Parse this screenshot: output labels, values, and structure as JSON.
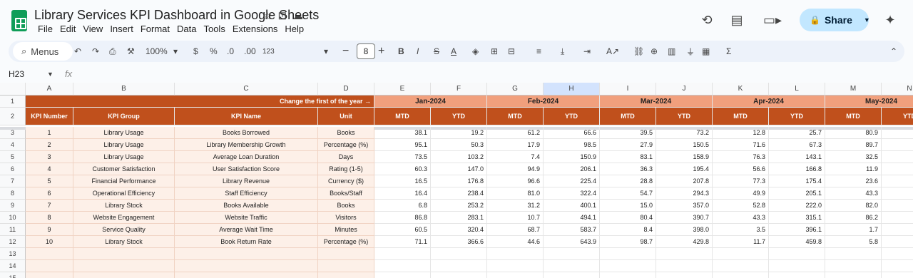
{
  "app": {
    "title": "Library Services KPI Dashboard in Google Sheets",
    "menus": [
      "File",
      "Edit",
      "View",
      "Insert",
      "Format",
      "Data",
      "Tools",
      "Extensions",
      "Help"
    ],
    "share_label": "Share"
  },
  "toolbar": {
    "menus_label": "Menus",
    "zoom": "100%",
    "currency": "$",
    "percent": "%",
    "dec_decrease": ".0",
    "dec_increase": ".00",
    "number_format": "123",
    "font_size": "8"
  },
  "namebox": {
    "ref": "H23",
    "fx": "fx"
  },
  "columns": [
    "A",
    "B",
    "C",
    "D",
    "E",
    "F",
    "G",
    "H",
    "I",
    "J",
    "K",
    "L",
    "M",
    "N"
  ],
  "rows": [
    "1",
    "2",
    "3",
    "4",
    "5",
    "6",
    "7",
    "8",
    "9",
    "10",
    "11",
    "12",
    "13",
    "14",
    "15"
  ],
  "sheet": {
    "banner": "Change the first of the year →",
    "months": [
      "Jan-2024",
      "Feb-2024",
      "Mar-2024",
      "Apr-2024",
      "May-2024"
    ],
    "headers": [
      "KPI Number",
      "KPI Group",
      "KPI Name",
      "Unit"
    ],
    "sub_headers": [
      "MTD",
      "YTD"
    ],
    "data": [
      [
        "1",
        "Library Usage",
        "Books Borrowed",
        "Books",
        "38.1",
        "19.2",
        "61.2",
        "66.6",
        "39.5",
        "73.2",
        "12.8",
        "25.7",
        "80.9",
        "33."
      ],
      [
        "2",
        "Library Usage",
        "Library Membership Growth",
        "Percentage (%)",
        "95.1",
        "50.3",
        "17.9",
        "98.5",
        "27.9",
        "150.5",
        "71.6",
        "67.3",
        "89.7",
        "85."
      ],
      [
        "3",
        "Library Usage",
        "Average Loan Duration",
        "Days",
        "73.5",
        "103.2",
        "7.4",
        "150.9",
        "83.1",
        "158.9",
        "76.3",
        "143.1",
        "32.5",
        "156"
      ],
      [
        "4",
        "Customer Satisfaction",
        "User Satisfaction Score",
        "Rating (1-5)",
        "60.3",
        "147.0",
        "94.9",
        "206.1",
        "36.3",
        "195.4",
        "56.6",
        "166.8",
        "11.9",
        "193"
      ],
      [
        "5",
        "Financial Performance",
        "Library Revenue",
        "Currency ($)",
        "16.5",
        "176.8",
        "96.6",
        "225.4",
        "28.8",
        "207.8",
        "77.3",
        "175.4",
        "23.6",
        "290"
      ],
      [
        "6",
        "Operational Efficiency",
        "Staff Efficiency",
        "Books/Staff",
        "16.4",
        "238.4",
        "81.0",
        "322.4",
        "54.7",
        "294.3",
        "49.9",
        "205.1",
        "43.3",
        "386"
      ],
      [
        "7",
        "Library Stock",
        "Books Available",
        "Books",
        "6.8",
        "253.2",
        "31.2",
        "400.1",
        "15.0",
        "357.0",
        "52.8",
        "222.0",
        "82.0",
        "412"
      ],
      [
        "8",
        "Website Engagement",
        "Website Traffic",
        "Visitors",
        "86.8",
        "283.1",
        "10.7",
        "494.1",
        "80.4",
        "390.7",
        "43.3",
        "315.1",
        "86.2",
        "462"
      ],
      [
        "9",
        "Service Quality",
        "Average Wait Time",
        "Minutes",
        "60.5",
        "320.4",
        "68.7",
        "583.7",
        "8.4",
        "398.0",
        "3.5",
        "396.1",
        "1.7",
        "499"
      ],
      [
        "10",
        "Library Stock",
        "Book Return Rate",
        "Percentage (%)",
        "71.1",
        "366.6",
        "44.6",
        "643.9",
        "98.7",
        "429.8",
        "11.7",
        "459.8",
        "5.8",
        "576"
      ]
    ]
  },
  "colors": {
    "dark_header": "#c0501c",
    "light_header": "#f1a07d",
    "info_fill": "#fdf0e8",
    "share_bg": "#c2e7ff"
  }
}
